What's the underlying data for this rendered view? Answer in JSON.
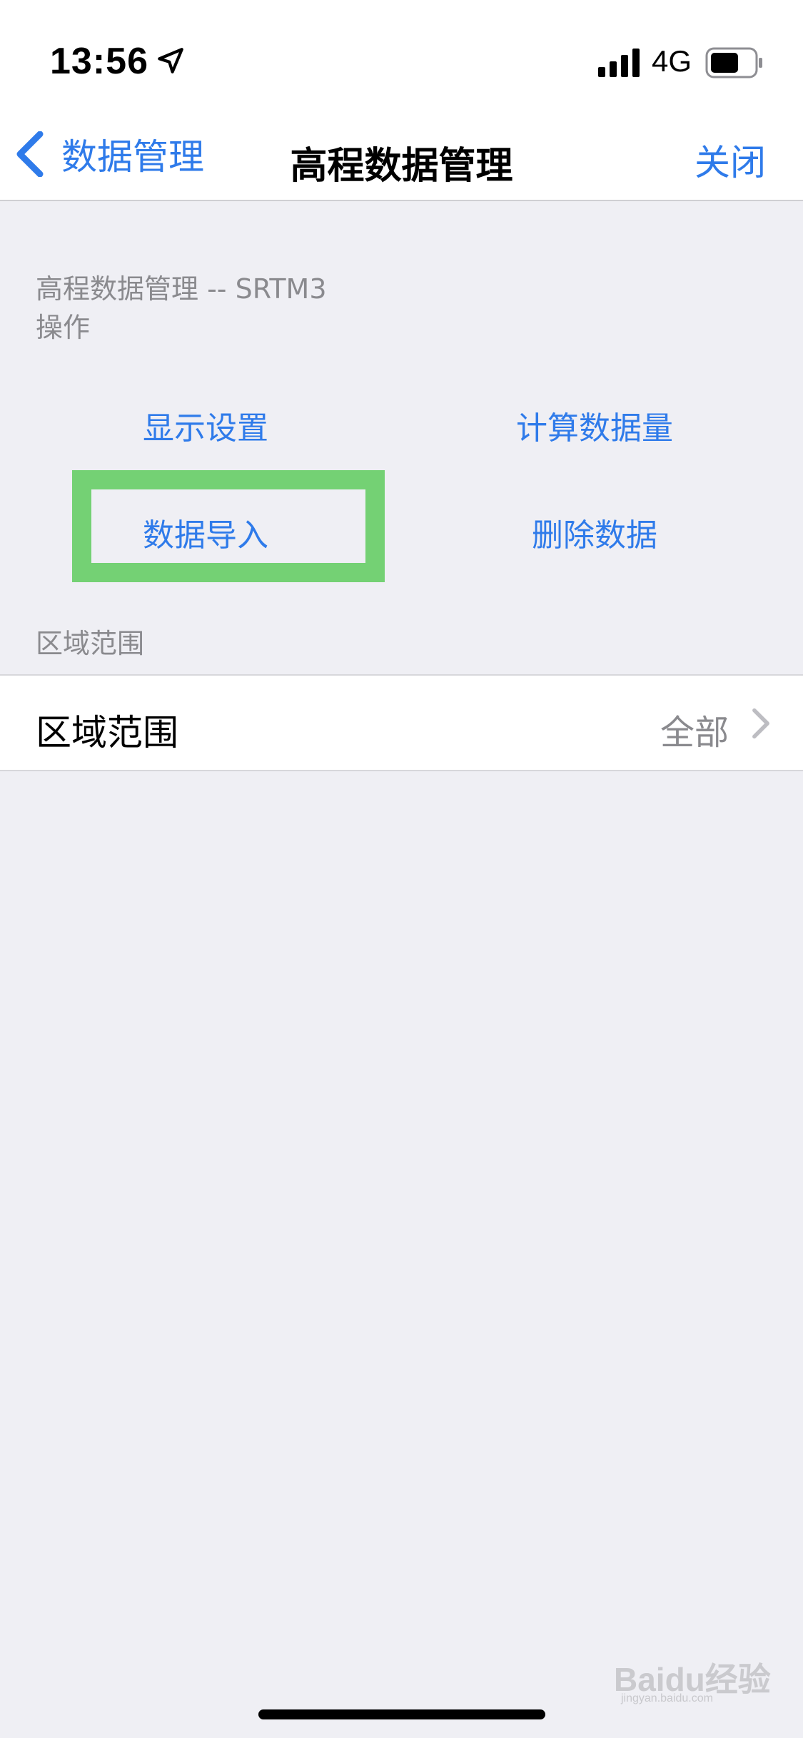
{
  "status_bar": {
    "time": "13:56",
    "network": "4G",
    "icons": [
      "location-arrow-icon",
      "signal-bars-icon",
      "battery-icon"
    ]
  },
  "nav": {
    "back_label": "数据管理",
    "title": "高程数据管理",
    "close_label": "关闭",
    "accent_color": "#2F7BEA"
  },
  "sections": {
    "header_line1": "高程数据管理 -- SRTM3",
    "header_line2": "操作",
    "region_header": "区域范围"
  },
  "actions": {
    "display_settings": "显示设置",
    "calc_data": "计算数据量",
    "import_data": "数据导入",
    "delete_data": "删除数据"
  },
  "region_row": {
    "label": "区域范围",
    "value": "全部"
  },
  "highlight": {
    "color": "#74D174",
    "target": "import_data"
  },
  "watermark": {
    "main": "Baidu经验",
    "sub": "jingyan.baidu.com"
  }
}
